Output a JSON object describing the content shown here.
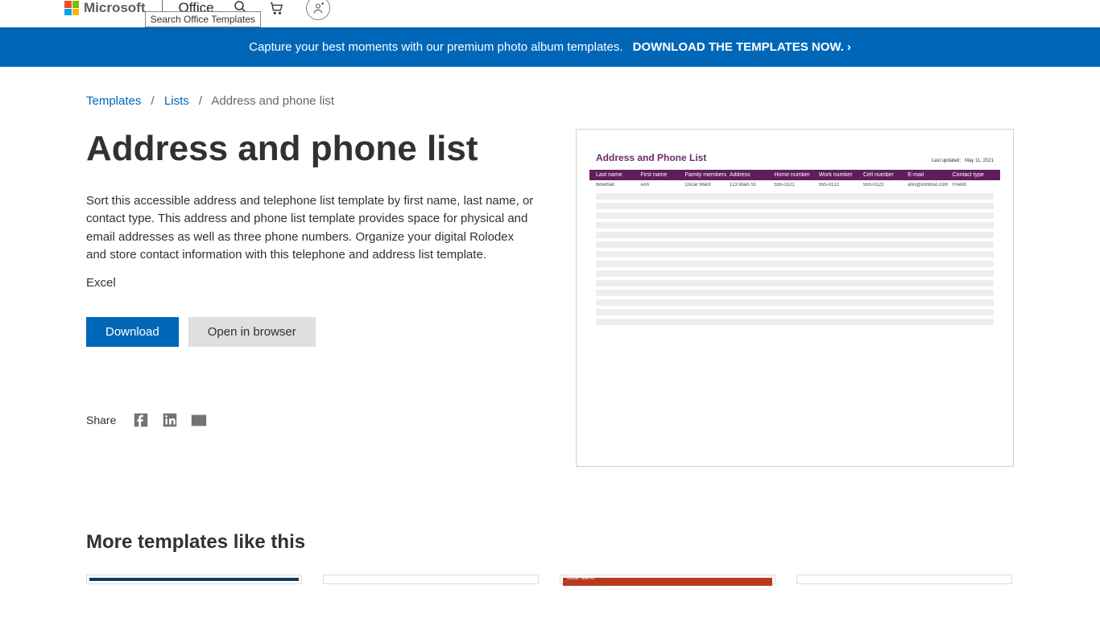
{
  "header": {
    "brand": "Microsoft",
    "product": "Office",
    "search_tooltip": "Search Office Templates"
  },
  "banner": {
    "text": "Capture your best moments with our premium photo album templates.",
    "cta": "DOWNLOAD THE TEMPLATES NOW."
  },
  "breadcrumb": {
    "root": "Templates",
    "section": "Lists",
    "current": "Address and phone list"
  },
  "page": {
    "title": "Address and phone list",
    "description": "Sort this accessible address and telephone list template by first name, last name, or contact type. This address and phone list template provides space for physical and email addresses as well as three phone numbers. Organize your digital Rolodex and store contact information with this telephone and address list template.",
    "app": "Excel",
    "download_label": "Download",
    "open_label": "Open in browser",
    "share_label": "Share"
  },
  "preview": {
    "title": "Address and Phone List",
    "updated_label": "Last updated:",
    "updated_date": "May 11, 2021",
    "columns": [
      "Last name",
      "First name",
      "Family members",
      "Address",
      "Home number",
      "Work number",
      "Cell number",
      "E-mail",
      "Contact type"
    ],
    "row": [
      "Bowman",
      "Ann",
      "Oscar Ward",
      "123 Main St.",
      "555-0121",
      "555-0122",
      "555-0123",
      "ann@contoso.com",
      "Friend"
    ]
  },
  "more": {
    "heading": "More templates like this",
    "card3_label": "Club Name"
  }
}
